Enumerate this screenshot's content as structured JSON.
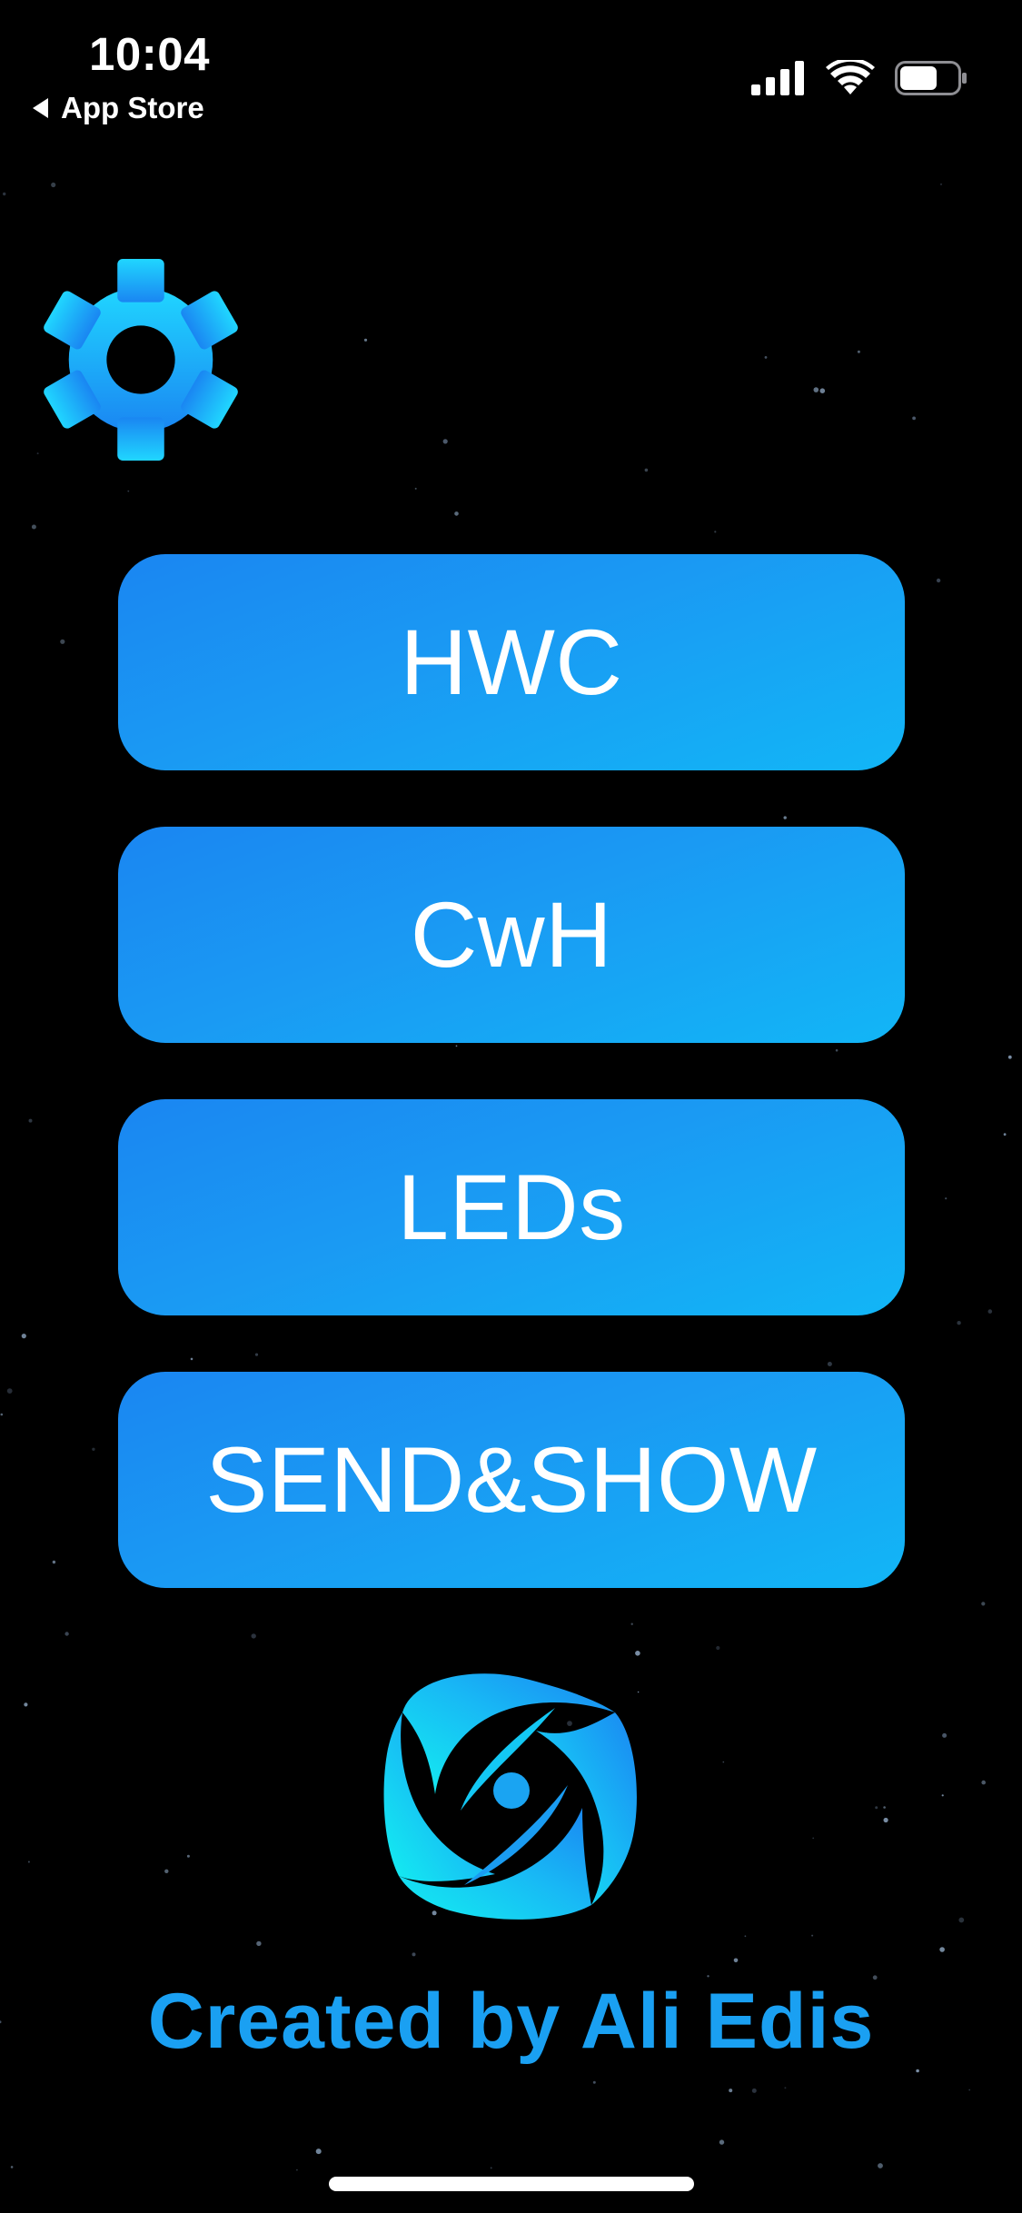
{
  "status_bar": {
    "time": "10:04",
    "back_label": "App Store",
    "signal_icon": "cellular-signal-icon",
    "wifi_icon": "wifi-icon",
    "battery_icon": "battery-icon"
  },
  "settings": {
    "icon": "gear-icon"
  },
  "menu": {
    "items": [
      {
        "label": "HWC"
      },
      {
        "label": "CwH"
      },
      {
        "label": "LEDs"
      },
      {
        "label": "SEND&SHOW"
      }
    ]
  },
  "logo": {
    "icon": "orbit-logo-icon"
  },
  "footer": {
    "credit": "Created by Ali Edis"
  },
  "colors": {
    "background": "#000000",
    "button_start": "#1a86f2",
    "button_end": "#12b6f6",
    "accent": "#1aa0f2",
    "logo_cyan": "#13f0f0"
  }
}
